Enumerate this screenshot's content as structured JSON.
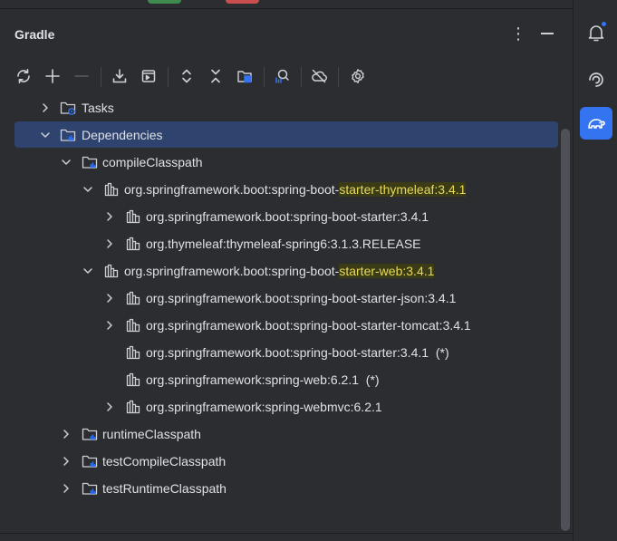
{
  "panel": {
    "title": "Gradle",
    "more_symbol": "⋮"
  },
  "toolbar": {
    "buttons": [
      {
        "name": "reload-all-icon"
      },
      {
        "name": "link-project-icon"
      },
      {
        "name": "unlink-project-icon"
      },
      {
        "name": "download-sources-icon"
      },
      {
        "name": "execute-task-icon"
      },
      {
        "name": "expand-all-icon"
      },
      {
        "name": "collapse-all-icon"
      },
      {
        "name": "group-modules-icon"
      },
      {
        "name": "analyze-dependencies-icon"
      },
      {
        "name": "offline-mode-icon"
      },
      {
        "name": "settings-icon"
      }
    ]
  },
  "tree": {
    "tasks": "Tasks",
    "dependencies": "Dependencies",
    "compileClasspath": "compileClasspath",
    "thymeleaf_prefix": "org.springframework.boot:spring-boot-",
    "thymeleaf_highlight": "starter-thymeleaf",
    "thymeleaf_suffix": ":3.4.1",
    "thymeleaf_child1": "org.springframework.boot:spring-boot-starter:3.4.1",
    "thymeleaf_child2": "org.thymeleaf:thymeleaf-spring6:3.1.3.RELEASE",
    "web_prefix": "org.springframework.boot:spring-boot-",
    "web_highlight": "starter-web",
    "web_suffix": ":3.4.1",
    "web_child1": "org.springframework.boot:spring-boot-starter-json:3.4.1",
    "web_child2": "org.springframework.boot:spring-boot-starter-tomcat:3.4.1",
    "web_child3": "org.springframework.boot:spring-boot-starter:3.4.1",
    "web_child3_mark": "(*)",
    "web_child4": "org.springframework:spring-web:6.2.1",
    "web_child4_mark": "(*)",
    "web_child5": "org.springframework:spring-webmvc:6.2.1",
    "runtimeClasspath": "runtimeClasspath",
    "testCompileClasspath": "testCompileClasspath",
    "testRuntimeClasspath": "testRuntimeClasspath"
  },
  "right_strip": [
    {
      "name": "notifications-icon",
      "has_badge": true
    },
    {
      "name": "ai-assistant-icon"
    },
    {
      "name": "gradle-elephant-icon",
      "active": true
    }
  ],
  "colors": {
    "background": "#2b2d30",
    "selection": "#2e436e",
    "highlight_text": "#e6d95b",
    "accent": "#3574f0"
  }
}
